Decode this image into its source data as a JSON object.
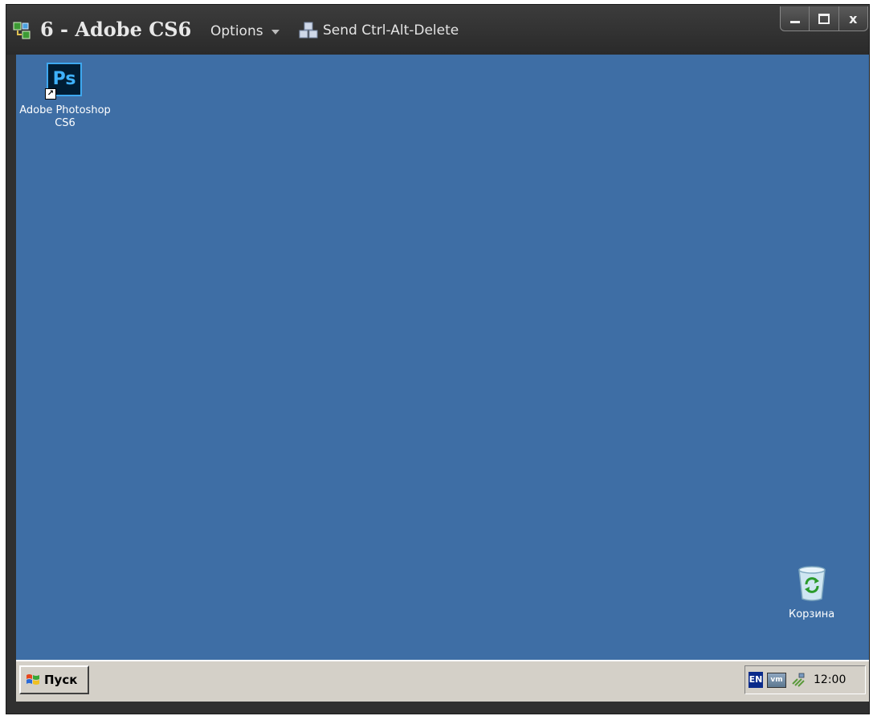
{
  "window": {
    "title": "6 - Adobe CS6",
    "options_label": "Options",
    "send_cad_label": "Send Ctrl-Alt-Delete",
    "controls": {
      "minimize_icon": "minimize-icon",
      "maximize_icon": "maximize-icon",
      "close_label": "x"
    }
  },
  "desktop": {
    "background_color": "#3e6ea5",
    "icons": [
      {
        "icon": "photoshop-icon",
        "glyph": "Ps",
        "label": "Adobe Photoshop CS6"
      },
      {
        "icon": "recycle-bin-icon",
        "label": "Корзина"
      }
    ]
  },
  "taskbar": {
    "start_label": "Пуск",
    "tray": {
      "language": "EN",
      "vmware_glyph": "vm",
      "clock": "12:00"
    }
  }
}
